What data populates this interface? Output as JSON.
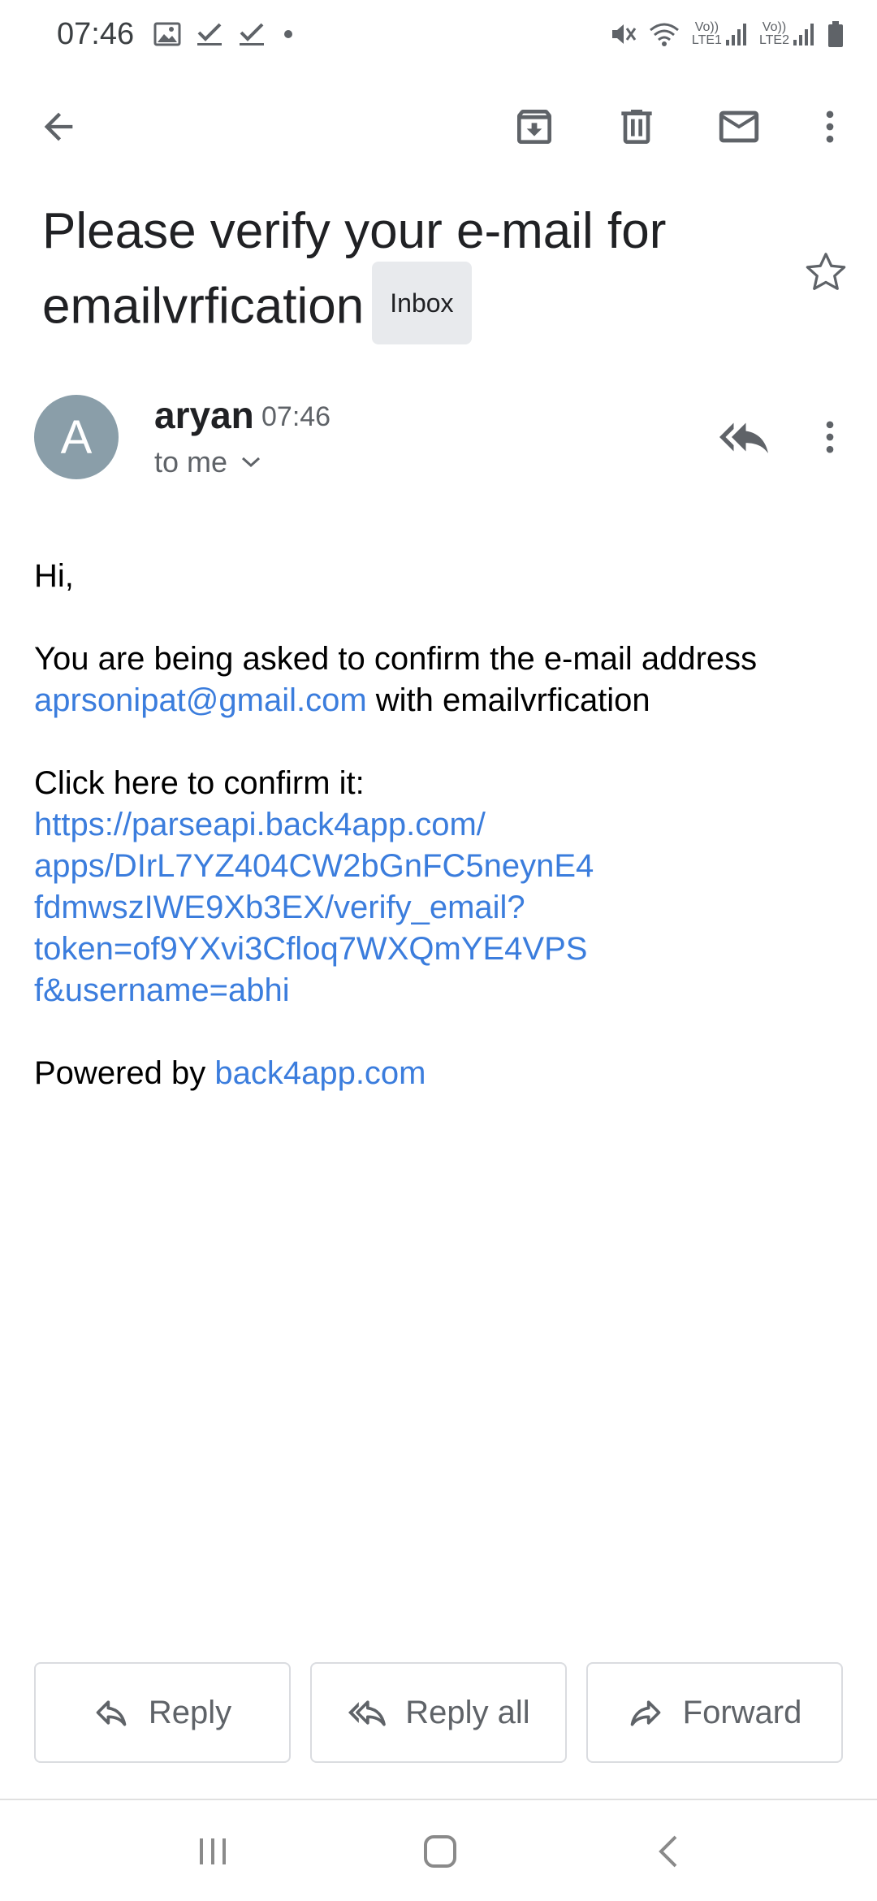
{
  "status_bar": {
    "time": "07:46",
    "left_icons": [
      "image-icon",
      "check-icon",
      "check-icon",
      "dot-icon"
    ],
    "right_icons": [
      "mute-icon",
      "wifi-icon",
      "signal-lte1-icon",
      "signal-lte2-icon",
      "battery-icon"
    ],
    "sim1_label_top": "Vo))",
    "sim1_label_bottom": "LTE1",
    "sim2_label_top": "Vo))",
    "sim2_label_bottom": "LTE2"
  },
  "toolbar": {
    "icons": [
      "back-arrow-icon",
      "archive-icon",
      "delete-icon",
      "mail-icon",
      "more-vert-icon"
    ]
  },
  "email": {
    "subject": "Please verify your e-mail for emailvrfication",
    "label_chip": "Inbox",
    "sender_initial": "A",
    "sender_name": "aryan",
    "time": "07:46",
    "recipient": "to me",
    "greeting": "Hi,",
    "line1": "You are being asked to confirm the e-mail address",
    "email_link": "aprsonipat@gmail.com",
    "line1_suffix": " with emailvrfication",
    "confirm_text": "Click here to confirm it:",
    "confirm_link_lines": [
      "https://parseapi.back4app.com/",
      "apps/DIrL7YZ404CW2bGnFC5neynE4",
      "fdmwszIWE9Xb3EX/verify_email?",
      "token=of9YXvi3Cfloq7WXQmYE4VPS",
      "f&username=abhi"
    ],
    "powered_prefix": "Powered by ",
    "powered_link": "back4app.com"
  },
  "actions": {
    "reply": "Reply",
    "reply_all": "Reply all",
    "forward": "Forward"
  },
  "colors": {
    "link": "#3b7ddd",
    "avatar": "#8a9ea9",
    "chip_bg": "#e8eaed"
  }
}
